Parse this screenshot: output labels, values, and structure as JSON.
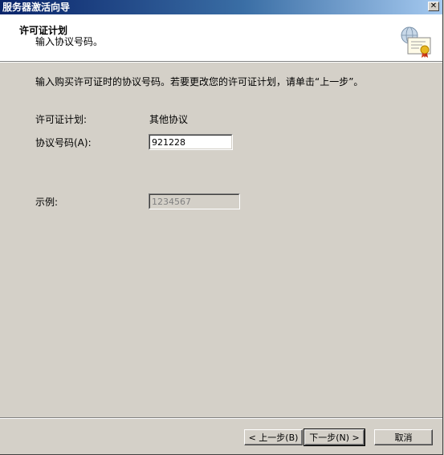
{
  "window": {
    "title": "服务器激活向导",
    "close_label": "✕"
  },
  "header": {
    "title": "许可证计划",
    "subtitle": "输入协议号码。",
    "icon": "certificate-icon"
  },
  "body": {
    "instruction": "输入购买许可证时的协议号码。若要更改您的许可证计划，请单击“上一步”。",
    "plan_label": "许可证计划:",
    "plan_value": "其他协议",
    "agreement_label": "协议号码(A):",
    "agreement_value": "921228",
    "example_label": "示例:",
    "example_value": "1234567"
  },
  "buttons": {
    "back": "< 上一步(B)",
    "next": "下一步(N) >",
    "cancel": "取消"
  }
}
